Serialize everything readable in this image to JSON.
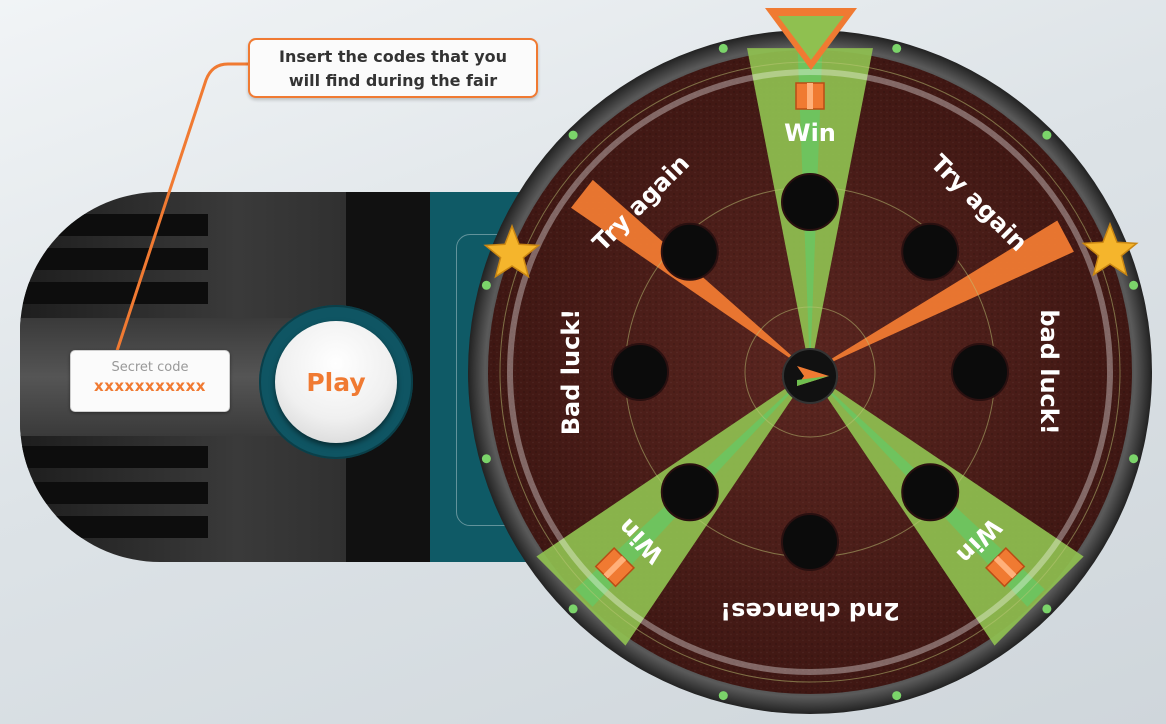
{
  "callout": {
    "line1": "Insert the codes that you",
    "line2": "will find during the fair"
  },
  "code_input": {
    "label": "Secret code",
    "value": "xxxxxxxxxxx"
  },
  "play_button": {
    "label": "Play"
  },
  "wheel": {
    "segments": [
      {
        "label": "Win",
        "angle": 0,
        "type": "win"
      },
      {
        "label": "Try again",
        "angle": 45,
        "type": "plain"
      },
      {
        "label": "bad luck!",
        "angle": 90,
        "type": "plain"
      },
      {
        "label": "Win",
        "angle": 135,
        "type": "win"
      },
      {
        "label": "2nd chances!",
        "angle": 180,
        "type": "plain"
      },
      {
        "label": "Win",
        "angle": 225,
        "type": "win"
      },
      {
        "label": "Bad luck!",
        "angle": 270,
        "type": "plain"
      },
      {
        "label": "Try again",
        "angle": 315,
        "type": "plain"
      }
    ]
  },
  "colors": {
    "accent": "#f07a32",
    "win_green": "#8fc050",
    "wheel_brown": "#4e1f1a",
    "teal": "#0f5a66"
  },
  "icons": {
    "pointer": "triangle-pointer-icon",
    "star": "star-icon",
    "gift": "gift-icon",
    "hub": "play-arrow-icon"
  }
}
